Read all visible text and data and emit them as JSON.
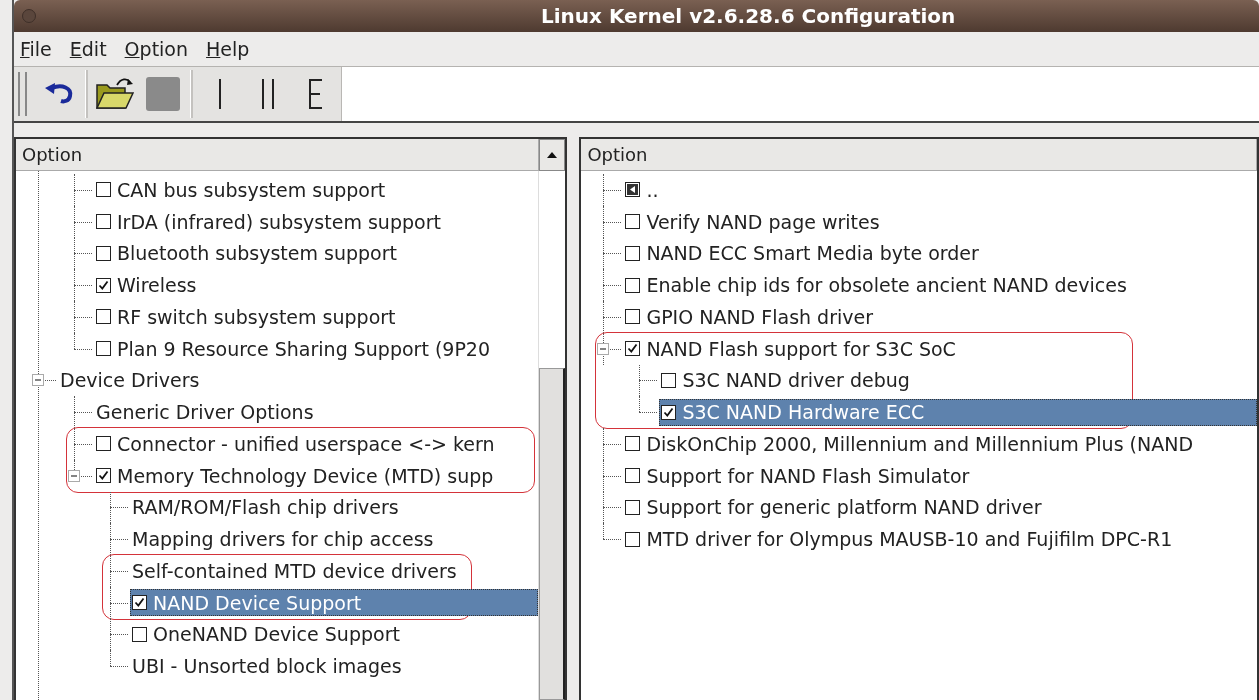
{
  "window": {
    "title": "Linux Kernel v2.6.28.6 Configuration"
  },
  "menu": [
    "File",
    "Edit",
    "Option",
    "Help"
  ],
  "toolbar": [
    {
      "kind": "handle"
    },
    {
      "kind": "undo"
    },
    {
      "kind": "separator"
    },
    {
      "kind": "open"
    },
    {
      "kind": "save",
      "disabled": true
    },
    {
      "kind": "separator"
    },
    {
      "kind": "single"
    },
    {
      "kind": "split"
    },
    {
      "kind": "full"
    }
  ],
  "left_panel": {
    "header": "Option",
    "continues_below": true,
    "tree": [
      {
        "children": [
          {
            "kind": "check",
            "label": "CAN bus subsystem support",
            "checked": false,
            "selected": false,
            "outlined": false
          },
          {
            "kind": "check",
            "label": "IrDA (infrared) subsystem support",
            "checked": false,
            "selected": false,
            "outlined": false
          },
          {
            "kind": "check",
            "label": "Bluetooth subsystem support",
            "checked": false,
            "selected": false,
            "outlined": false
          },
          {
            "kind": "check",
            "label": "Wireless",
            "checked": true,
            "selected": false,
            "outlined": false
          },
          {
            "kind": "check",
            "label": "RF switch subsystem support",
            "checked": false,
            "selected": false,
            "outlined": false
          },
          {
            "kind": "check",
            "label": "Plan 9 Resource Sharing Support (9P20",
            "checked": false,
            "selected": false,
            "outlined": false
          }
        ]
      },
      {
        "kind": "menu",
        "label": "Device Drivers",
        "expanded": true,
        "selected": false,
        "outlined": false,
        "children": [
          {
            "kind": "menu",
            "label": "Generic Driver Options",
            "selected": false,
            "outlined": false
          },
          {
            "kind": "check",
            "label": "Connector - unified userspace <-> kern",
            "checked": false,
            "selected": false,
            "outlined": true
          },
          {
            "kind": "check",
            "label": "Memory Technology Device (MTD) supp",
            "checked": true,
            "expanded": true,
            "selected": false,
            "outlined": true,
            "children": [
              {
                "kind": "menu",
                "label": "RAM/ROM/Flash chip drivers",
                "selected": false,
                "outlined": false
              },
              {
                "kind": "menu",
                "label": "Mapping drivers for chip access",
                "selected": false,
                "outlined": false
              },
              {
                "kind": "menu",
                "label": "Self-contained MTD device drivers",
                "selected": false,
                "outlined": true
              },
              {
                "kind": "check",
                "label": "NAND Device Support",
                "checked": true,
                "selected": true,
                "outlined": true
              },
              {
                "kind": "check",
                "label": "OneNAND Device Support",
                "checked": false,
                "selected": false,
                "outlined": false
              },
              {
                "kind": "menu",
                "label": "UBI - Unsorted block images",
                "selected": false,
                "outlined": false
              }
            ]
          }
        ]
      }
    ]
  },
  "right_panel": {
    "header": "Option",
    "tree": [
      {
        "kind": "back",
        "label": "..",
        "selected": false,
        "outlined": false
      },
      {
        "kind": "check",
        "label": "Verify NAND page writes",
        "checked": false,
        "selected": false,
        "outlined": false
      },
      {
        "kind": "check",
        "label": "NAND ECC Smart Media byte order",
        "checked": false,
        "selected": false,
        "outlined": false
      },
      {
        "kind": "check",
        "label": "Enable chip ids for obsolete ancient NAND devices",
        "checked": false,
        "selected": false,
        "outlined": false
      },
      {
        "kind": "check",
        "label": "GPIO NAND Flash driver",
        "checked": false,
        "selected": false,
        "outlined": false
      },
      {
        "kind": "check",
        "label": "NAND Flash support for S3C SoC",
        "checked": true,
        "expanded": true,
        "selected": false,
        "outlined": true,
        "children": [
          {
            "kind": "check",
            "label": "S3C NAND driver debug",
            "checked": false,
            "selected": false,
            "outlined": true
          },
          {
            "kind": "check",
            "label": "S3C NAND Hardware ECC",
            "checked": true,
            "selected": true,
            "outlined": true
          }
        ]
      },
      {
        "kind": "check",
        "label": "DiskOnChip 2000, Millennium and Millennium Plus (NAND",
        "checked": false,
        "selected": false,
        "outlined": false
      },
      {
        "kind": "check",
        "label": "Support for NAND Flash Simulator",
        "checked": false,
        "selected": false,
        "outlined": false
      },
      {
        "kind": "check",
        "label": "Support for generic platform NAND driver",
        "checked": false,
        "selected": false,
        "outlined": false
      },
      {
        "kind": "check",
        "label": "MTD driver for Olympus MAUSB-10 and Fujifilm DPC-R1",
        "checked": false,
        "selected": false,
        "outlined": false
      }
    ]
  }
}
